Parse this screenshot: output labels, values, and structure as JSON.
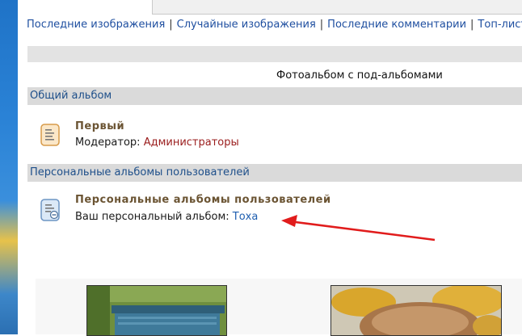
{
  "nav": {
    "items": [
      "Последние изображения",
      "Случайные изображения",
      "Последние комментарии",
      "Топ-лист"
    ],
    "separator": "|"
  },
  "page": {
    "title": "Фотоальбом с под-альбомами"
  },
  "categories": [
    {
      "header": "Общий альбом",
      "album_name": "Первый",
      "meta_label": "Модератор:",
      "meta_value": "Администраторы"
    },
    {
      "header": "Персональные альбомы пользователей",
      "album_name": "Персональные альбомы пользователей",
      "meta_label": "Ваш персональный альбом:",
      "meta_value": "Тоха"
    }
  ],
  "colors": {
    "link": "#1f4fa0",
    "header_text": "#1e4f8a",
    "album_name": "#6b5433",
    "moderator": "#9a1c1c",
    "arrow": "#e11c1c"
  },
  "icons": {
    "album_a": "album-document-icon",
    "album_b": "album-personal-icon"
  }
}
